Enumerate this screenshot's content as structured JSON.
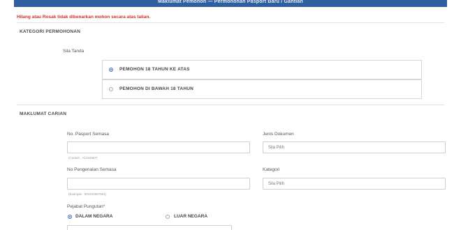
{
  "header": {
    "title": "Maklumat Pemohon — Permohonan Pasport Baru / Gantian"
  },
  "notice": "Hilang atau Rosak tidak dibenarkan mohon secara atas talian.",
  "sections": {
    "kategori": "KATEGORI PERMOHONAN",
    "carian": "MAKLUMAT CARIAN"
  },
  "kategori": {
    "label": "Sila Tanda",
    "options": [
      {
        "label": "PEMOHON 18 TAHUN KE ATAS",
        "selected": true
      },
      {
        "label": "PEMOHON DI BAWAH 18 TAHUN",
        "selected": false
      }
    ]
  },
  "form": {
    "passport": {
      "label": "No. Pasport Semasa",
      "value": "",
      "hint": "(Contoh : A1234567)"
    },
    "jenis": {
      "label": "Jenis Dokumen",
      "value": "Sila Pilih"
    },
    "ic": {
      "label": "No Pengenalan Semasa",
      "value": "",
      "hint": "(Example : 801234567891)"
    },
    "kategori": {
      "label": "Kategori",
      "value": "Sila Pilih"
    },
    "pejabat": {
      "label": "Pejabat Pungutan",
      "required_mark": "*",
      "options": [
        {
          "label": "DALAM NEGARA",
          "selected": true
        },
        {
          "label": "LUAR NEGARA",
          "selected": false
        }
      ]
    }
  },
  "colors": {
    "header": "#2f5f9e",
    "accent": "#3a6fc0",
    "warning": "#d0302a"
  }
}
